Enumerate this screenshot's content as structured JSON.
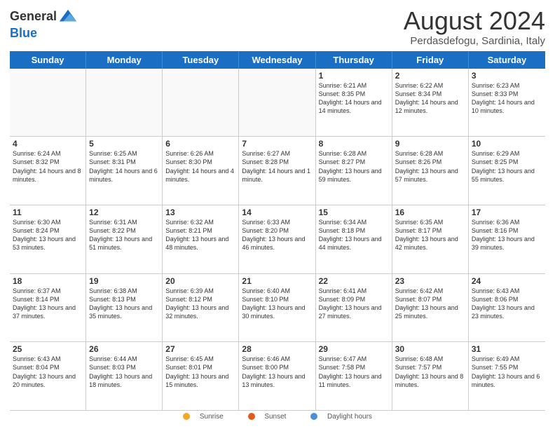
{
  "header": {
    "logo_line1": "General",
    "logo_line2": "Blue",
    "month_title": "August 2024",
    "location": "Perdasdefogu, Sardinia, Italy"
  },
  "weekdays": [
    "Sunday",
    "Monday",
    "Tuesday",
    "Wednesday",
    "Thursday",
    "Friday",
    "Saturday"
  ],
  "weeks": [
    [
      {
        "day": "",
        "empty": true
      },
      {
        "day": "",
        "empty": true
      },
      {
        "day": "",
        "empty": true
      },
      {
        "day": "",
        "empty": true
      },
      {
        "day": "1",
        "sunrise": "6:21 AM",
        "sunset": "8:35 PM",
        "daylight": "14 hours and 14 minutes."
      },
      {
        "day": "2",
        "sunrise": "6:22 AM",
        "sunset": "8:34 PM",
        "daylight": "14 hours and 12 minutes."
      },
      {
        "day": "3",
        "sunrise": "6:23 AM",
        "sunset": "8:33 PM",
        "daylight": "14 hours and 10 minutes."
      }
    ],
    [
      {
        "day": "4",
        "sunrise": "6:24 AM",
        "sunset": "8:32 PM",
        "daylight": "14 hours and 8 minutes."
      },
      {
        "day": "5",
        "sunrise": "6:25 AM",
        "sunset": "8:31 PM",
        "daylight": "14 hours and 6 minutes."
      },
      {
        "day": "6",
        "sunrise": "6:26 AM",
        "sunset": "8:30 PM",
        "daylight": "14 hours and 4 minutes."
      },
      {
        "day": "7",
        "sunrise": "6:27 AM",
        "sunset": "8:28 PM",
        "daylight": "14 hours and 1 minute."
      },
      {
        "day": "8",
        "sunrise": "6:28 AM",
        "sunset": "8:27 PM",
        "daylight": "13 hours and 59 minutes."
      },
      {
        "day": "9",
        "sunrise": "6:28 AM",
        "sunset": "8:26 PM",
        "daylight": "13 hours and 57 minutes."
      },
      {
        "day": "10",
        "sunrise": "6:29 AM",
        "sunset": "8:25 PM",
        "daylight": "13 hours and 55 minutes."
      }
    ],
    [
      {
        "day": "11",
        "sunrise": "6:30 AM",
        "sunset": "8:24 PM",
        "daylight": "13 hours and 53 minutes."
      },
      {
        "day": "12",
        "sunrise": "6:31 AM",
        "sunset": "8:22 PM",
        "daylight": "13 hours and 51 minutes."
      },
      {
        "day": "13",
        "sunrise": "6:32 AM",
        "sunset": "8:21 PM",
        "daylight": "13 hours and 48 minutes."
      },
      {
        "day": "14",
        "sunrise": "6:33 AM",
        "sunset": "8:20 PM",
        "daylight": "13 hours and 46 minutes."
      },
      {
        "day": "15",
        "sunrise": "6:34 AM",
        "sunset": "8:18 PM",
        "daylight": "13 hours and 44 minutes."
      },
      {
        "day": "16",
        "sunrise": "6:35 AM",
        "sunset": "8:17 PM",
        "daylight": "13 hours and 42 minutes."
      },
      {
        "day": "17",
        "sunrise": "6:36 AM",
        "sunset": "8:16 PM",
        "daylight": "13 hours and 39 minutes."
      }
    ],
    [
      {
        "day": "18",
        "sunrise": "6:37 AM",
        "sunset": "8:14 PM",
        "daylight": "13 hours and 37 minutes."
      },
      {
        "day": "19",
        "sunrise": "6:38 AM",
        "sunset": "8:13 PM",
        "daylight": "13 hours and 35 minutes."
      },
      {
        "day": "20",
        "sunrise": "6:39 AM",
        "sunset": "8:12 PM",
        "daylight": "13 hours and 32 minutes."
      },
      {
        "day": "21",
        "sunrise": "6:40 AM",
        "sunset": "8:10 PM",
        "daylight": "13 hours and 30 minutes."
      },
      {
        "day": "22",
        "sunrise": "6:41 AM",
        "sunset": "8:09 PM",
        "daylight": "13 hours and 27 minutes."
      },
      {
        "day": "23",
        "sunrise": "6:42 AM",
        "sunset": "8:07 PM",
        "daylight": "13 hours and 25 minutes."
      },
      {
        "day": "24",
        "sunrise": "6:43 AM",
        "sunset": "8:06 PM",
        "daylight": "13 hours and 23 minutes."
      }
    ],
    [
      {
        "day": "25",
        "sunrise": "6:43 AM",
        "sunset": "8:04 PM",
        "daylight": "13 hours and 20 minutes."
      },
      {
        "day": "26",
        "sunrise": "6:44 AM",
        "sunset": "8:03 PM",
        "daylight": "13 hours and 18 minutes."
      },
      {
        "day": "27",
        "sunrise": "6:45 AM",
        "sunset": "8:01 PM",
        "daylight": "13 hours and 15 minutes."
      },
      {
        "day": "28",
        "sunrise": "6:46 AM",
        "sunset": "8:00 PM",
        "daylight": "13 hours and 13 minutes."
      },
      {
        "day": "29",
        "sunrise": "6:47 AM",
        "sunset": "7:58 PM",
        "daylight": "13 hours and 11 minutes."
      },
      {
        "day": "30",
        "sunrise": "6:48 AM",
        "sunset": "7:57 PM",
        "daylight": "13 hours and 8 minutes."
      },
      {
        "day": "31",
        "sunrise": "6:49 AM",
        "sunset": "7:55 PM",
        "daylight": "13 hours and 6 minutes."
      }
    ]
  ],
  "footer": {
    "sunrise_label": "Sunrise",
    "sunset_label": "Sunset",
    "daylight_label": "Daylight hours"
  }
}
